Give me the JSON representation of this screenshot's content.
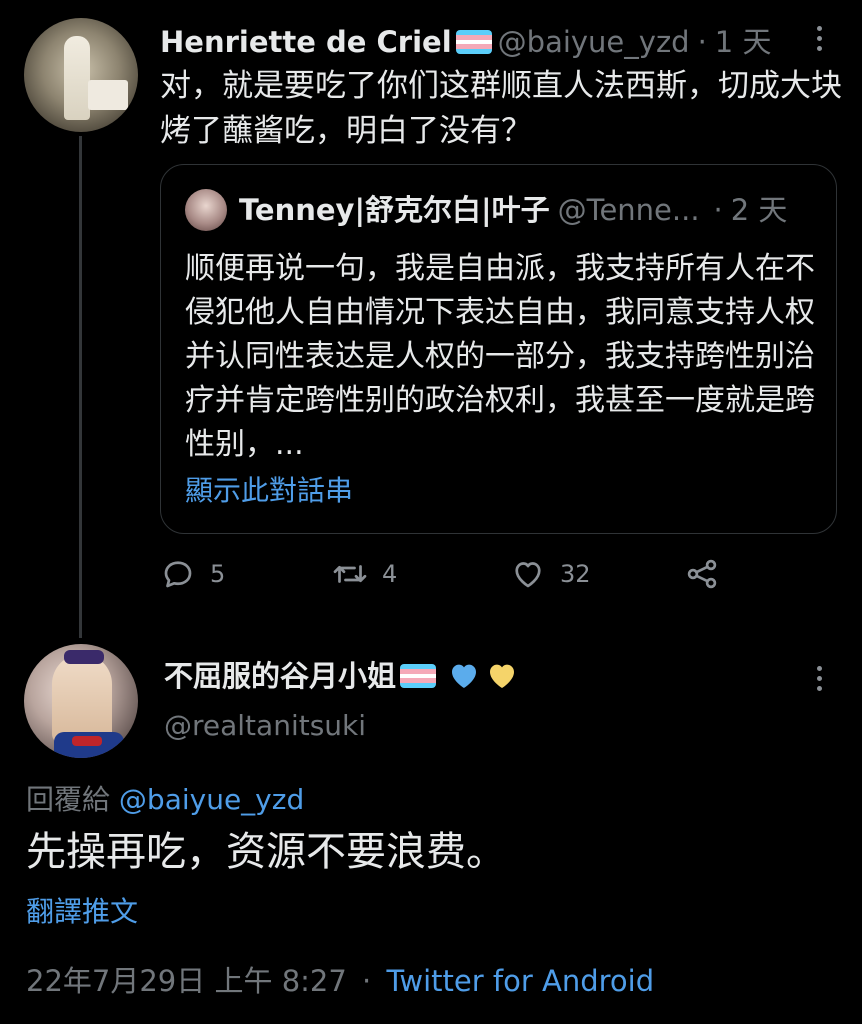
{
  "parent_tweet": {
    "display_name": "Henriette de Criel",
    "handle": "@baiyue_yzd",
    "separator": "·",
    "time": "1 天",
    "text": "对，就是要吃了你们这群顺直人法西斯，切成大块烤了蘸酱吃，明白了没有？",
    "quote": {
      "display_name": "Tenney|舒克尔白|叶子",
      "handle": "@Tenne...",
      "separator": "·",
      "time": "2 天",
      "text": "顺便再说一句，我是自由派，我支持所有人在不侵犯他人自由情况下表达自由，我同意支持人权并认同性表达是人权的一部分，我支持跨性别治疗并肯定跨性别的政治权利，我甚至一度就是跨性别，...",
      "show_thread": "顯示此對話串"
    },
    "actions": {
      "reply_count": "5",
      "retweet_count": "4",
      "like_count": "32"
    }
  },
  "reply_tweet": {
    "display_name": "不屈服的谷月小姐",
    "handle": "@realtanitsuki",
    "replying_prefix": "回覆給",
    "replying_to": "@baiyue_yzd",
    "text": "先操再吃，资源不要浪费。",
    "translate": "翻譯推文",
    "timestamp": "22年7月29日 上午 8:27",
    "separator": "·",
    "source": "Twitter for Android"
  },
  "colors": {
    "background": "#000000",
    "text": "#e7e9ea",
    "muted": "#71767b",
    "link": "#4f9de8",
    "heart_blue": "#5bacec",
    "heart_yellow": "#f5d46a"
  },
  "icons": [
    "more-options-icon",
    "reply-icon",
    "retweet-icon",
    "like-icon",
    "share-icon",
    "trans-flag-icon",
    "blue-heart-icon",
    "yellow-heart-icon"
  ]
}
